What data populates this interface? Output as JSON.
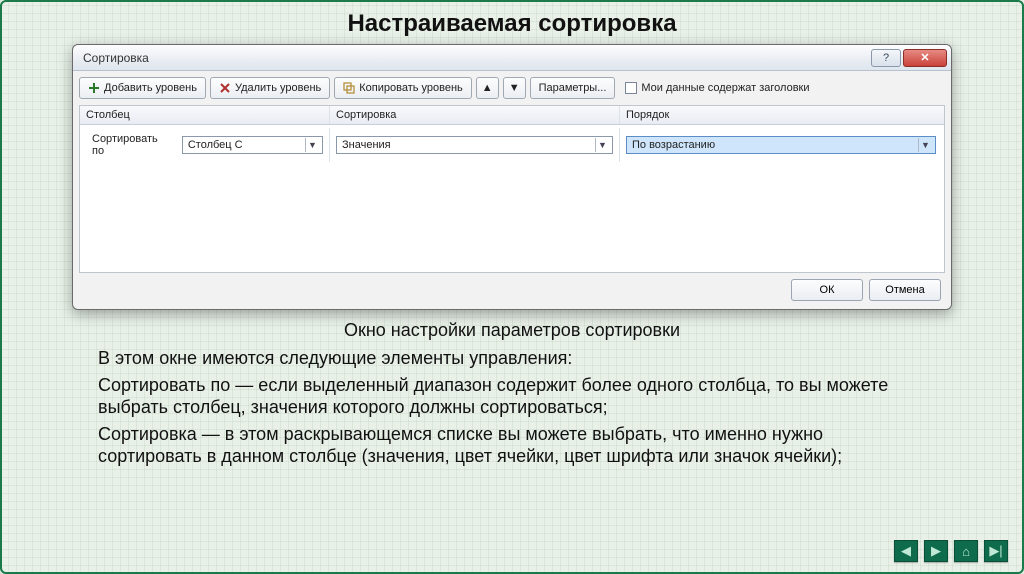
{
  "page": {
    "title": "Настраиваемая сортировка",
    "caption": "Окно настройки параметров сортировки",
    "paragraphs": [
      "В этом окне имеются следующие элементы управления:",
      "Сортировать по — если выделенный диапазон содержит более одного столбца, то вы можете выбрать столбец, значения которого должны сортироваться;",
      "Сортировка — в этом раскрывающемся списке вы можете выбрать, что именно нужно сортировать в данном столбце (значения, цвет ячейки, цвет шрифта или значок ячейки);"
    ]
  },
  "dialog": {
    "title": "Сортировка",
    "help_glyph": "?",
    "close_glyph": "✕",
    "toolbar": {
      "add_label": "Добавить уровень",
      "delete_label": "Удалить уровень",
      "copy_label": "Копировать уровень",
      "up_glyph": "▲",
      "down_glyph": "▼",
      "options_label": "Параметры...",
      "headers_checkbox_label": "Мои данные содержат заголовки"
    },
    "grid": {
      "headers": {
        "column": "Столбец",
        "sort": "Сортировка",
        "order": "Порядок"
      },
      "row": {
        "label": "Сортировать по",
        "column_value": "Столбец C",
        "sort_value": "Значения",
        "order_value": "По возрастанию"
      }
    },
    "footer": {
      "ok": "ОК",
      "cancel": "Отмена"
    }
  },
  "nav": {
    "prev_glyph": "◀",
    "next_glyph": "▶",
    "home_glyph": "⌂",
    "end_glyph": "▶|"
  }
}
